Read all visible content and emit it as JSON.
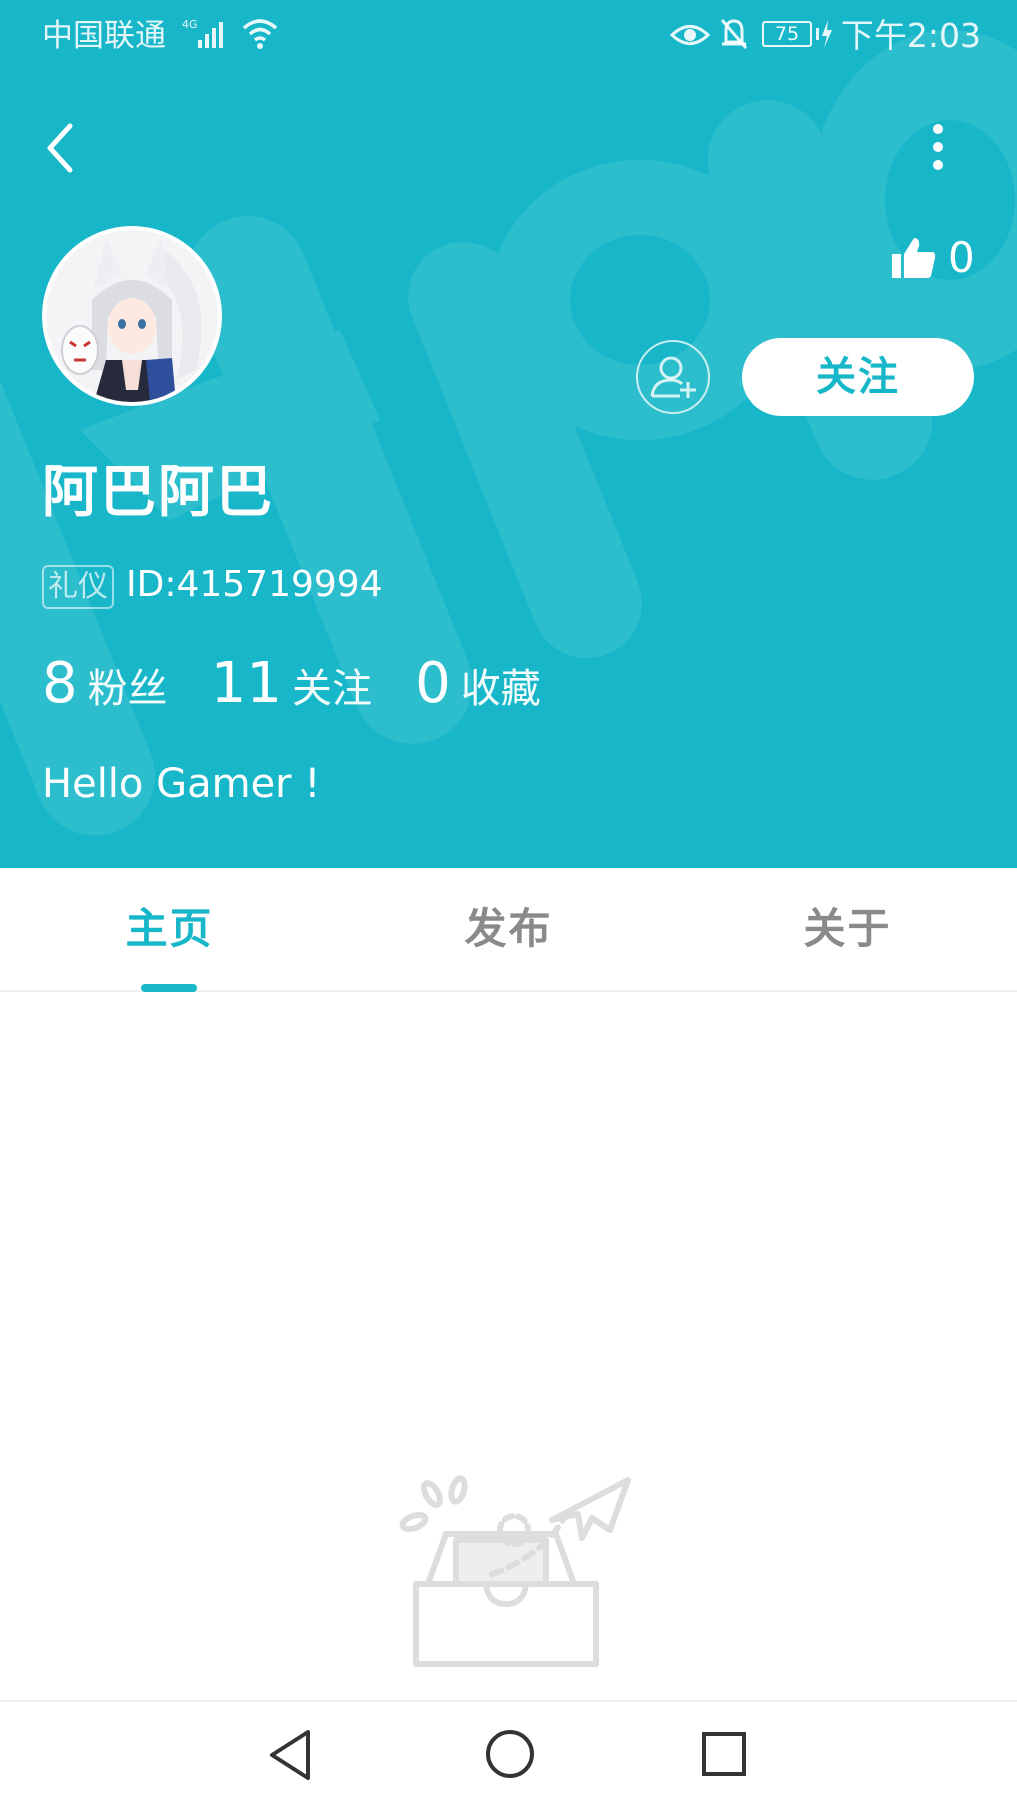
{
  "status_bar": {
    "carrier": "中国联通",
    "network": "4G",
    "battery": "75",
    "time": "下午2:03"
  },
  "profile": {
    "like_count": "0",
    "follow_label": "关注",
    "username": "阿巴阿巴",
    "badge": "礼仪",
    "user_id": "ID:415719994",
    "bio": "Hello Gamer !",
    "stats": [
      {
        "value": "8",
        "label": "粉丝"
      },
      {
        "value": "11",
        "label": "关注"
      },
      {
        "value": "0",
        "label": "收藏"
      }
    ]
  },
  "tabs": [
    {
      "label": "主页",
      "active": true
    },
    {
      "label": "发布",
      "active": false
    },
    {
      "label": "关于",
      "active": false
    }
  ],
  "icons": {
    "back": "back-arrow-icon",
    "more": "more-vertical-icon",
    "like": "thumbs-up-icon",
    "add_friend": "add-friend-icon",
    "empty": "empty-inbox-icon"
  },
  "colors": {
    "accent": "#17b7c9",
    "inactive_tab": "#8a8a8a"
  }
}
